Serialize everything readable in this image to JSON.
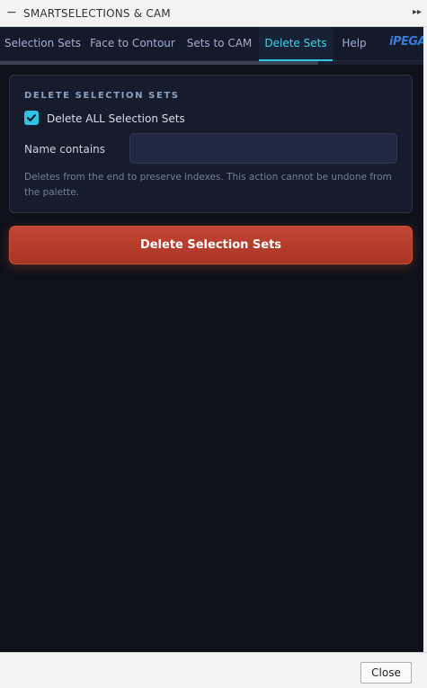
{
  "window": {
    "title": "SMARTSELECTIONS & CAM",
    "collapse_glyph": "−",
    "expand_glyph": "▸▸"
  },
  "tabs": [
    {
      "label": "Selection Sets",
      "active": false
    },
    {
      "label": "Face to Contour",
      "active": false
    },
    {
      "label": "Sets to CAM",
      "active": false
    },
    {
      "label": "Delete Sets",
      "active": true
    },
    {
      "label": "Help",
      "active": false
    }
  ],
  "logo": {
    "text": "iPEGA"
  },
  "section": {
    "heading": "DELETE SELECTION SETS",
    "checkbox": {
      "label": "Delete ALL Selection Sets",
      "checked": true
    },
    "name_field": {
      "label": "Name contains",
      "value": "",
      "placeholder": ""
    },
    "helper": "Deletes from the end to preserve indexes. This action cannot be undone from the palette."
  },
  "action_button": {
    "label": "Delete Selection Sets"
  },
  "footer": {
    "close_label": "Close"
  },
  "colors": {
    "accent": "#2fc6e3",
    "danger": "#b73b2c",
    "panel_bg": "#0e111a",
    "card_bg": "#161c2b"
  }
}
